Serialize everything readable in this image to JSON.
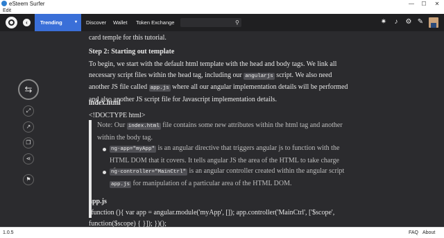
{
  "window": {
    "title": "eSteem Surfer",
    "min": "—",
    "max": "☐",
    "close": "✕"
  },
  "menu": {
    "edit": "Edit"
  },
  "nav": {
    "back": "‹",
    "trending": "Trending",
    "caret": "▾",
    "discover": "Discover",
    "wallet": "Wallet",
    "token_exchange": "Token Exchange",
    "search_placeholder": "",
    "search_icon": "⚲",
    "icons": {
      "gear": "✷",
      "bell": "♪",
      "settings": "⚙",
      "edit": "✎"
    }
  },
  "sidebar": {
    "reblog": "⇆",
    "expand": "⤢",
    "external": "↗",
    "copy": "❐",
    "share": "⋖",
    "flag": "⚑"
  },
  "article": {
    "intro_tail": "card temple for this tutorial.",
    "step2_heading": "Step 2: Starting out template",
    "para1_a": "To begin, we start with the default html template with the head and body tags. We link all necessary script files within the head tag, including our ",
    "para1_code1": "angularjs",
    "para1_b": " script. We also need another JS file called ",
    "para1_code2": "app.js",
    "para1_c": " where all our angular implementation details will be performed and also another JS script file for Javascript implementation details.",
    "index_heading": "index.html",
    "doctype": "<!DOCTYPE html>",
    "note_a": "Note: Our ",
    "note_code": "index.html",
    "note_b": " file contains some new attributes within the html tag and another within the body tag.",
    "li1_code": "ng-app=\"myApp\"",
    "li1_text": " is an angular directive that triggers angular js to function with the HTML DOM that it covers. It tells angular JS the area of the HTML to take charge of.",
    "li2_code1": "ng-controller=\"MainCtrl\"",
    "li2_text1": " is an angular controller created within the angular script ",
    "li2_code2": "app.js",
    "li2_text2": " for manipulation of a particular area of the HTML DOM.",
    "appjs_heading": "app.js",
    "code_line": "(function (){ var app = angular.module('myApp', []); app.controller('MainCtrl', ['$scope', function($scope) { }]); })();"
  },
  "status": {
    "version": "1.0.5",
    "faq": "FAQ",
    "about": "About"
  }
}
